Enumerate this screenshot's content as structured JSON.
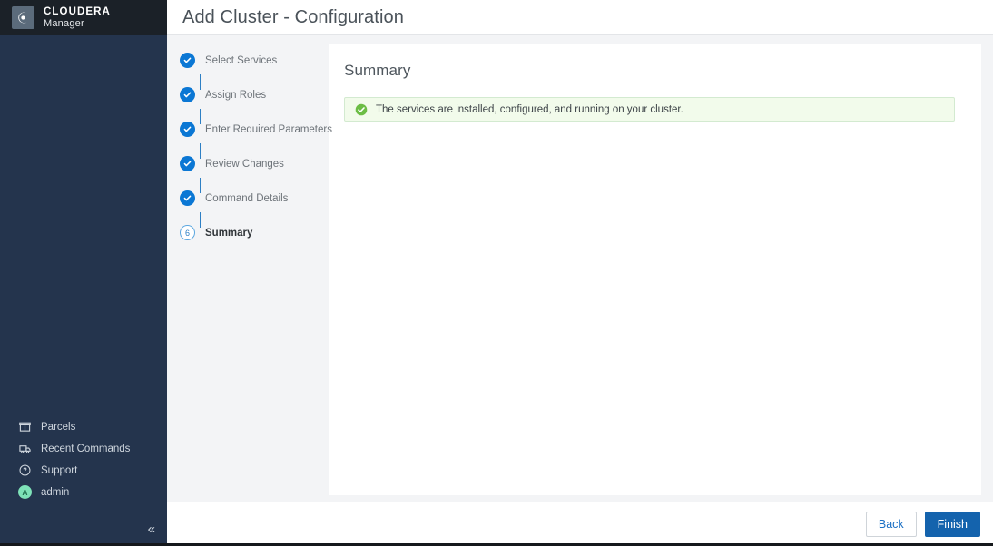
{
  "brand": {
    "logo_icon": "cloudera-c-logo-icon",
    "title": "CLOUDERA",
    "subtitle": "Manager"
  },
  "sidebar": {
    "items": [
      {
        "label": "Parcels",
        "icon": "parcel-box-icon"
      },
      {
        "label": "Recent Commands",
        "icon": "recent-commands-icon"
      },
      {
        "label": "Support",
        "icon": "question-circle-icon"
      },
      {
        "label": "admin",
        "icon": "avatar-icon",
        "avatar_initial": "A"
      }
    ],
    "collapse_label": "«",
    "background_color": "#24344d",
    "brand_background_color": "#1b2128",
    "avatar_color": "#7ee2b8"
  },
  "header": {
    "title": "Add Cluster - Configuration"
  },
  "wizard": {
    "steps": [
      {
        "number": "1",
        "label": "Select Services",
        "state": "done"
      },
      {
        "number": "2",
        "label": "Assign Roles",
        "state": "done"
      },
      {
        "number": "3",
        "label": "Enter Required Parameters",
        "state": "done"
      },
      {
        "number": "4",
        "label": "Review Changes",
        "state": "done"
      },
      {
        "number": "5",
        "label": "Command Details",
        "state": "done"
      },
      {
        "number": "6",
        "label": "Summary",
        "state": "current"
      }
    ],
    "done_color": "#0b77d4",
    "current_color": "#2d7fc4"
  },
  "content": {
    "heading": "Summary",
    "alert": {
      "icon": "success-check-icon",
      "message": "The services are installed, configured, and running on your cluster.",
      "background_color": "#f2fbeb",
      "border_color": "#d3ead0",
      "icon_color": "#62b345"
    }
  },
  "footer": {
    "back_label": "Back",
    "finish_label": "Finish",
    "primary_color": "#1463ad"
  }
}
